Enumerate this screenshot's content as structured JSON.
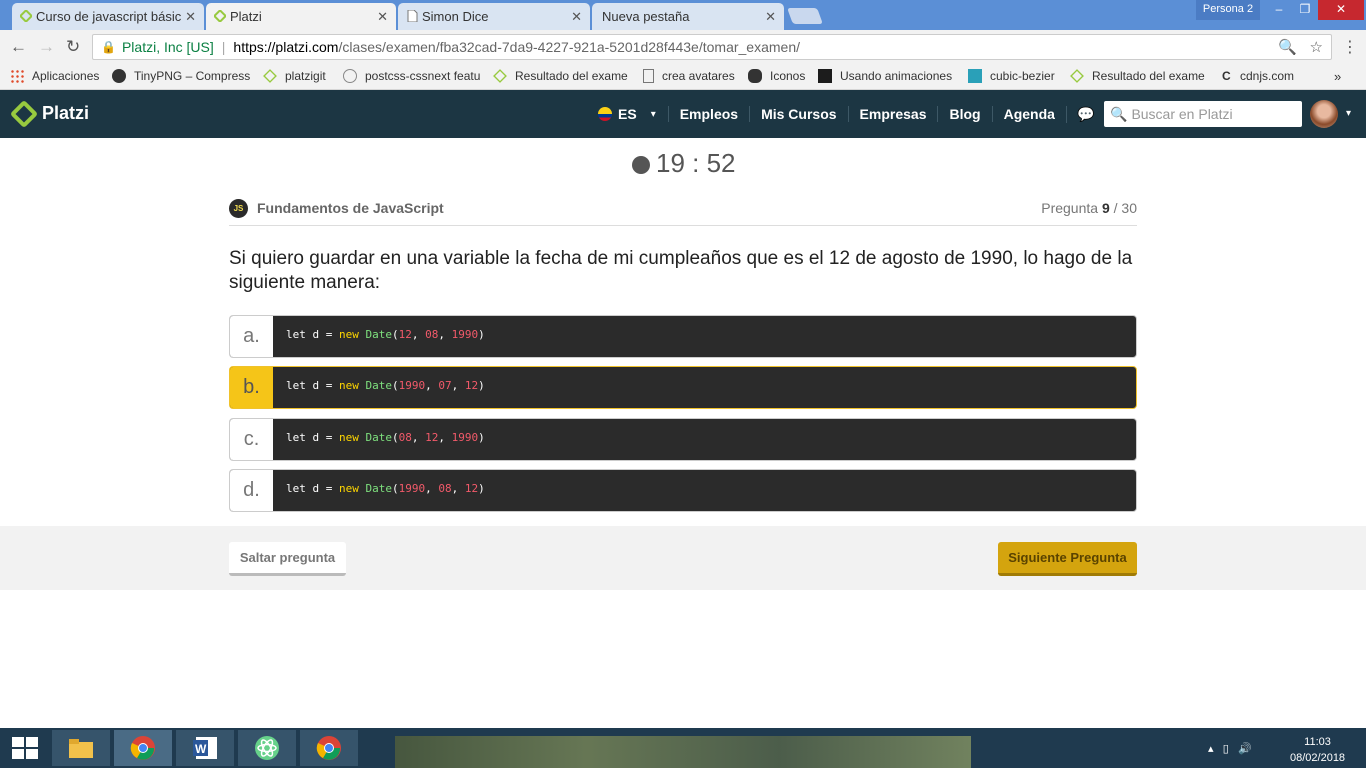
{
  "browser": {
    "tabs": [
      {
        "title": "Curso de javascript básic",
        "icon": "platzi-icon",
        "active": false
      },
      {
        "title": "Platzi",
        "icon": "platzi-icon",
        "active": true
      },
      {
        "title": "Simon Dice",
        "icon": "page-icon",
        "active": false
      },
      {
        "title": "Nueva pestaña",
        "icon": "none",
        "active": false
      }
    ],
    "persona": "Persona 2",
    "secure_label": "Platzi, Inc [US]",
    "url_host": "https://platzi.com",
    "url_path": "/clases/examen/fba32cad-7da9-4227-921a-5201d28f443e/tomar_examen/",
    "bookmarks": [
      {
        "label": "Aplicaciones",
        "icon": "apps-grid-icon"
      },
      {
        "label": "TinyPNG – Compress",
        "icon": "panda-icon"
      },
      {
        "label": "platzigit",
        "icon": "platzi-icon"
      },
      {
        "label": "postcss-cssnext featu",
        "icon": "postcss-icon"
      },
      {
        "label": "Resultado del exame",
        "icon": "platzi-icon"
      },
      {
        "label": "crea avatares",
        "icon": "page-icon"
      },
      {
        "label": "Iconos",
        "icon": "binoculars-icon"
      },
      {
        "label": "Usando animaciones",
        "icon": "mdn-icon"
      },
      {
        "label": "cubic-bezier",
        "icon": "curve-icon"
      },
      {
        "label": "Resultado del exame",
        "icon": "platzi-icon"
      },
      {
        "label": "cdnjs.com",
        "icon": "cdnjs-icon"
      }
    ]
  },
  "header": {
    "logo": "Platzi",
    "lang": "ES",
    "nav": [
      "Empleos",
      "Mis Cursos",
      "Empresas",
      "Blog",
      "Agenda"
    ],
    "search_placeholder": "Buscar en Platzi"
  },
  "exam": {
    "timer": "19 : 52",
    "course_badge": "JS",
    "course": "Fundamentos de JavaScript",
    "counter_label": "Pregunta",
    "counter_current": "9",
    "counter_total": "/ 30",
    "question": "Si quiero guardar en una variable la fecha de mi cumpleaños que es el 12 de agosto de 1990, lo hago de la siguiente manera:",
    "options": [
      {
        "letter": "a.",
        "args": [
          "12",
          "08",
          "1990"
        ],
        "selected": false
      },
      {
        "letter": "b.",
        "args": [
          "1990",
          "07",
          "12"
        ],
        "selected": true
      },
      {
        "letter": "c.",
        "args": [
          "08",
          "12",
          "1990"
        ],
        "selected": false
      },
      {
        "letter": "d.",
        "args": [
          "1990",
          "08",
          "12"
        ],
        "selected": false
      }
    ],
    "code_prefix": "let d = ",
    "code_new": "new",
    "code_fn": "Date",
    "skip_label": "Saltar pregunta",
    "next_label": "Siguiente Pregunta"
  },
  "taskbar": {
    "time": "11:03",
    "date": "08/02/2018"
  },
  "colors": {
    "header_bg": "#1c3643",
    "platzi_green": "#98ca3f",
    "selected_yellow": "#f5c518",
    "next_button": "#d4a40e"
  }
}
